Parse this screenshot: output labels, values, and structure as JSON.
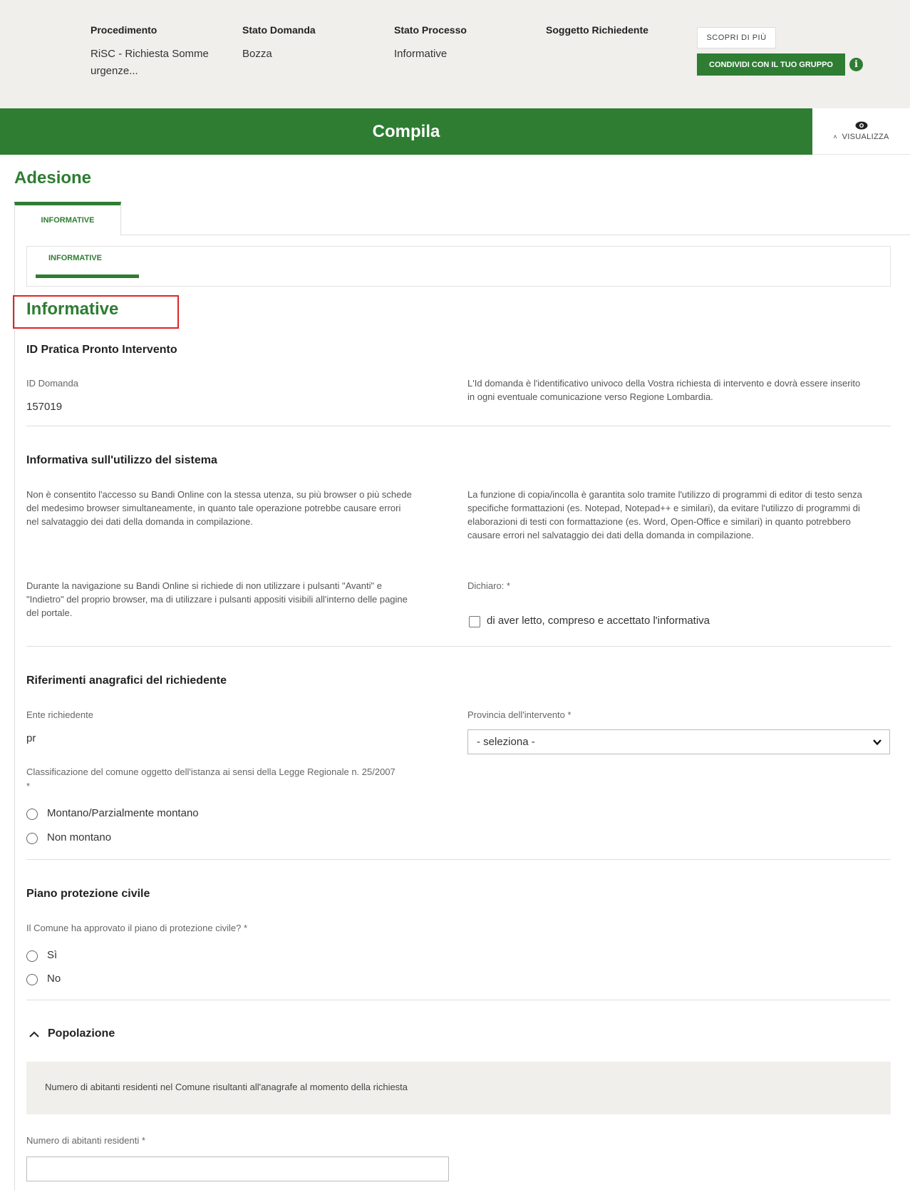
{
  "header": {
    "columns": [
      {
        "label": "Procedimento",
        "value": "RiSC - Richiesta Somme urgenze..."
      },
      {
        "label": "Stato Domanda",
        "value": "Bozza"
      },
      {
        "label": "Stato Processo",
        "value": "Informative"
      },
      {
        "label": "Soggetto Richiedente",
        "value": ""
      }
    ],
    "discover_button": "SCOPRI DI PIÙ",
    "share_button": "CONDIVIDI CON IL TUO GRUPPO",
    "info_icon": "i"
  },
  "compila": {
    "title": "Compila",
    "visualizza_label": "VISUALIZZA"
  },
  "section_title": "Adesione",
  "tabs": {
    "main": "INFORMATIVE",
    "sub": "INFORMATIVE"
  },
  "page_title": "Informative",
  "id_pratica": {
    "heading": "ID Pratica Pronto Intervento",
    "id_label": "ID Domanda",
    "id_value": "157019",
    "id_note": "L'Id domanda è l'identificativo univoco della Vostra richiesta di intervento e dovrà essere inserito in ogni eventuale comunicazione verso Regione Lombardia."
  },
  "informativa": {
    "heading": "Informativa sull'utilizzo del sistema",
    "para_left_1": "Non è consentito l'accesso su Bandi Online con la stessa utenza, su più browser o più schede del medesimo browser simultaneamente, in quanto tale operazione potrebbe causare errori nel salvataggio dei dati della domanda in compilazione.",
    "para_right_1": "La funzione di copia/incolla è garantita solo tramite l'utilizzo di programmi di editor di testo senza specifiche formattazioni (es. Notepad, Notepad++ e similari), da evitare l'utilizzo di programmi di elaborazioni di testi con formattazione (es. Word, Open-Office e similari) in quanto potrebbero causare errori nel salvataggio dei dati della domanda in compilazione.",
    "para_left_2": "Durante la navigazione su Bandi Online si richiede di non utilizzare i pulsanti \"Avanti\" e \"Indietro\" del proprio browser, ma di utilizzare i pulsanti appositi visibili all'interno delle pagine del portale.",
    "dichiaro_label": "Dichiaro: *",
    "checkbox_label": "di aver letto, compreso e accettato l'informativa"
  },
  "anagrafica": {
    "heading": "Riferimenti anagrafici del richiedente",
    "ente_label": "Ente richiedente",
    "ente_value": "pr",
    "provincia_label": "Provincia dell'intervento *",
    "provincia_selected": "- seleziona -",
    "classificazione_label": "Classificazione del comune oggetto dell'istanza ai sensi della Legge Regionale n. 25/2007",
    "classificazione_required": "*",
    "options": [
      "Montano/Parzialmente montano",
      "Non montano"
    ]
  },
  "piano": {
    "heading": "Piano protezione civile",
    "question": "Il Comune ha approvato il piano di protezione civile? *",
    "options": [
      "Sì",
      "No"
    ]
  },
  "popolazione": {
    "heading": "Popolazione",
    "note": "Numero di abitanti residenti nel Comune risultanti all'anagrafe al momento della richiesta",
    "field_label": "Numero di abitanti residenti *",
    "field_value": ""
  },
  "colors": {
    "accent": "#2e7d32",
    "highlight": "#e02424",
    "header_bg": "#f0efec"
  }
}
